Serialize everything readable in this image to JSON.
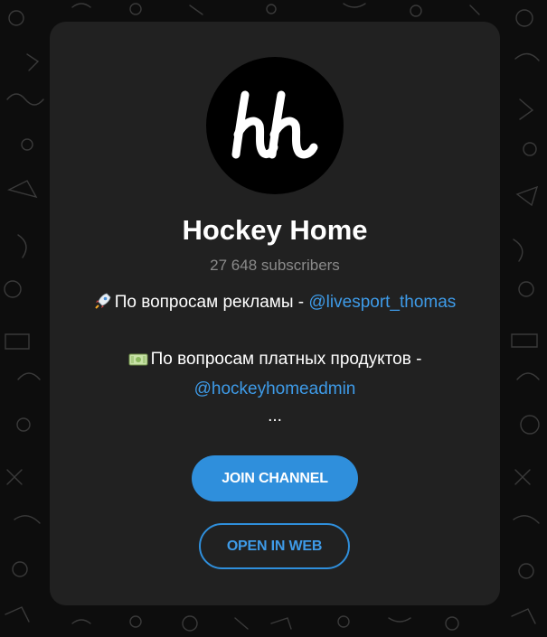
{
  "channel": {
    "title": "Hockey Home",
    "subscribers": "27 648 subscribers",
    "avatar_text": "hh"
  },
  "description": {
    "line1_icon": "rocket-icon",
    "line1_text": "По вопросам рекламы - ",
    "line1_link": "@livesport_thomas",
    "line2_icon": "money-icon",
    "line2_text": "По вопросам платных продуктов -",
    "line2_link": "@hockeyhomeadmin",
    "ellipsis": "..."
  },
  "buttons": {
    "join": "JOIN CHANNEL",
    "open_web": "OPEN IN WEB"
  },
  "colors": {
    "accent": "#2f8fdc",
    "card": "#212121",
    "background": "#0d0d0d"
  }
}
